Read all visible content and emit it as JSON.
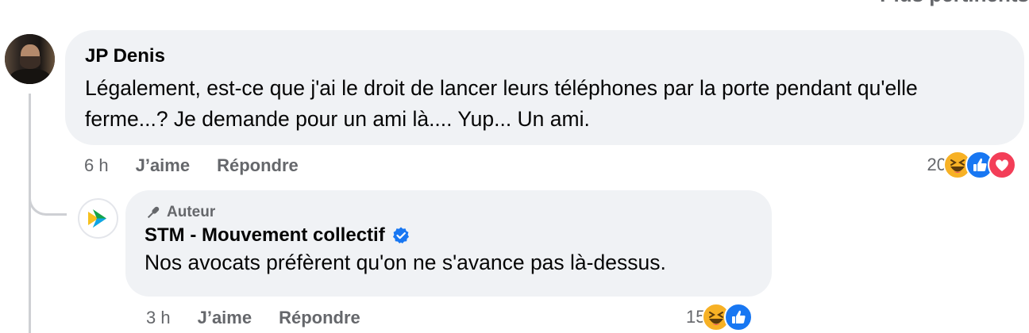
{
  "sort": {
    "label": "Plus pertinents"
  },
  "comment": {
    "author": "JP Denis",
    "text": "Légalement, est-ce que j'ai le droit de lancer leurs téléphones par la porte pendant qu'elle ferme...? Je demande pour un ami là.... Yup... Un ami.",
    "time": "6 h",
    "like_label": "J’aime",
    "reply_label": "Répondre",
    "reaction_count": "20",
    "reactions": [
      "haha-icon",
      "like-icon",
      "love-icon"
    ]
  },
  "reply": {
    "badge": "Auteur",
    "author": "STM - Mouvement collectif",
    "verified": true,
    "text": "Nos avocats préfèrent qu'on ne s'avance pas là-dessus.",
    "time": "3 h",
    "like_label": "J’aime",
    "reply_label": "Répondre",
    "reaction_count": "15",
    "reactions": [
      "haha-icon",
      "like-icon"
    ]
  },
  "colors": {
    "bubble_bg": "#f0f2f5",
    "secondary_text": "#65676b",
    "verified_blue": "#1877f2",
    "haha": "#f7b125",
    "like": "#1877f2",
    "love": "#f33e58"
  }
}
